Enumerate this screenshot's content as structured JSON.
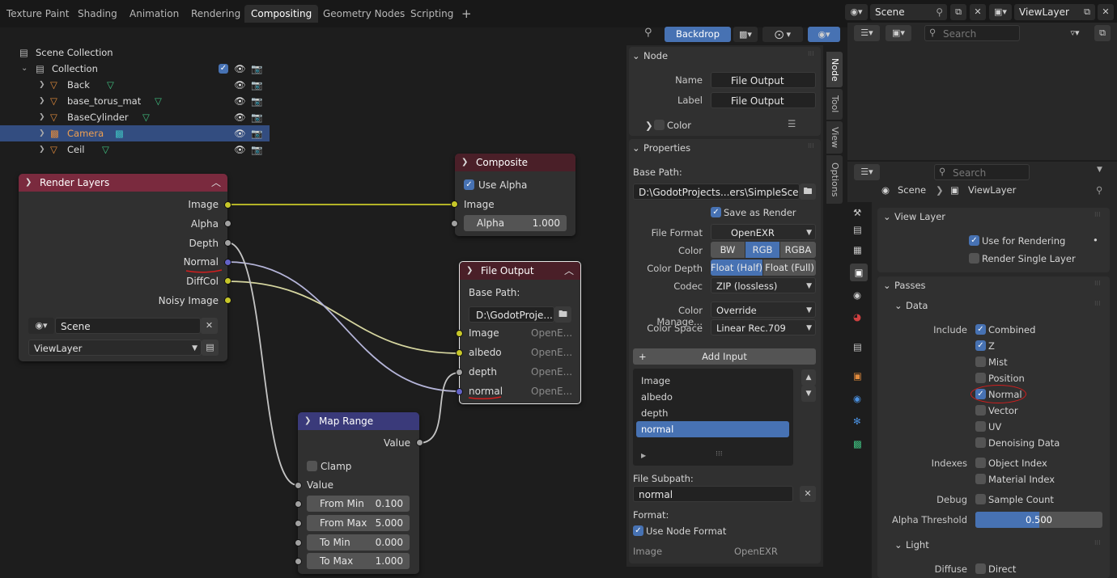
{
  "topbar": {
    "tabs": [
      "Texture Paint",
      "Shading",
      "Animation",
      "Rendering",
      "Compositing",
      "Geometry Nodes",
      "Scripting"
    ],
    "active_tab": "Compositing",
    "add_tab": "+",
    "scene": "Scene",
    "view_layer": "ViewLayer"
  },
  "editor_header": {
    "backdrop": "Backdrop"
  },
  "nodes": {
    "render_layers": {
      "title": "Render Layers",
      "outputs": [
        "Image",
        "Alpha",
        "Depth",
        "Normal",
        "DiffCol",
        "Noisy Image"
      ],
      "scene": "Scene",
      "view_layer": "ViewLayer"
    },
    "composite": {
      "title": "Composite",
      "use_alpha": "Use Alpha",
      "input_image": "Image",
      "alpha_label": "Alpha",
      "alpha_value": "1.000"
    },
    "file_output": {
      "title": "File Output",
      "base_path_label": "Base Path:",
      "base_path": "D:\\GodotProje...",
      "inputs": [
        {
          "name": "Image",
          "format": "OpenE..."
        },
        {
          "name": "albedo",
          "format": "OpenE..."
        },
        {
          "name": "depth",
          "format": "OpenE..."
        },
        {
          "name": "normal",
          "format": "OpenE..."
        }
      ]
    },
    "map_range": {
      "title": "Map Range",
      "output": "Value",
      "clamp": "Clamp",
      "input_value": "Value",
      "fields": [
        {
          "label": "From Min",
          "value": "0.100"
        },
        {
          "label": "From Max",
          "value": "5.000"
        },
        {
          "label": "To Min",
          "value": "0.000"
        },
        {
          "label": "To Max",
          "value": "1.000"
        }
      ]
    }
  },
  "npanel": {
    "node_header": "Node",
    "name_label": "Name",
    "name_value": "File Output",
    "label_label": "Label",
    "label_value": "File Output",
    "color": "Color",
    "properties_header": "Properties",
    "base_path_label": "Base Path:",
    "base_path": "D:\\GodotProjects...ers\\SimpleScene\\",
    "save_as_render": "Save as Render",
    "file_format_label": "File Format",
    "file_format": "OpenEXR",
    "color_label": "Color",
    "color_opts": [
      "BW",
      "RGB",
      "RGBA"
    ],
    "color_depth_label": "Color Depth",
    "color_depth_opts": [
      "Float (Half)",
      "Float (Full)"
    ],
    "codec_label": "Codec",
    "codec": "ZIP (lossless)",
    "color_manage_label": "Color Manage...",
    "color_manage": "Override",
    "color_space_label": "Color Space",
    "color_space": "Linear Rec.709",
    "add_input": "Add Input",
    "inputs": [
      "Image",
      "albedo",
      "depth",
      "normal"
    ],
    "selected_input": "normal",
    "file_subpath_label": "File Subpath:",
    "file_subpath": "normal",
    "format_label": "Format:",
    "use_node_format": "Use Node Format",
    "image_label": "Image",
    "image_format": "OpenEXR",
    "side_tabs": [
      "Node",
      "Tool",
      "View",
      "Options"
    ]
  },
  "outliner": {
    "search_placeholder": "Search",
    "scene_collection": "Scene Collection",
    "collection": "Collection",
    "items": [
      "Back",
      "base_torus_mat",
      "BaseCylinder",
      "Camera",
      "Ceil"
    ],
    "selected": "Camera"
  },
  "properties": {
    "search_placeholder": "Search",
    "breadcrumb_scene": "Scene",
    "breadcrumb_layer": "ViewLayer",
    "view_layer_header": "View Layer",
    "use_for_rendering": "Use for Rendering",
    "render_single_layer": "Render Single Layer",
    "passes_header": "Passes",
    "data_header": "Data",
    "include_label": "Include",
    "data_passes": [
      {
        "label": "Combined",
        "checked": true
      },
      {
        "label": "Z",
        "checked": true
      },
      {
        "label": "Mist",
        "checked": false
      },
      {
        "label": "Position",
        "checked": false
      },
      {
        "label": "Normal",
        "checked": true
      },
      {
        "label": "Vector",
        "checked": false
      },
      {
        "label": "UV",
        "checked": false
      },
      {
        "label": "Denoising Data",
        "checked": false
      }
    ],
    "indexes_label": "Indexes",
    "indexes": [
      "Object Index",
      "Material Index"
    ],
    "debug_label": "Debug",
    "sample_count": "Sample Count",
    "alpha_threshold_label": "Alpha Threshold",
    "alpha_threshold": "0.500",
    "light_header": "Light",
    "diffuse_label": "Diffuse",
    "direct": "Direct"
  },
  "colors": {
    "render_layers_header": "#7a2a3e",
    "composite_header": "#4a1f28",
    "file_output_header": "#4a1f28",
    "map_range_header": "#3a3a7a",
    "accent": "#4772b3",
    "annotation": "#d21e1e"
  }
}
